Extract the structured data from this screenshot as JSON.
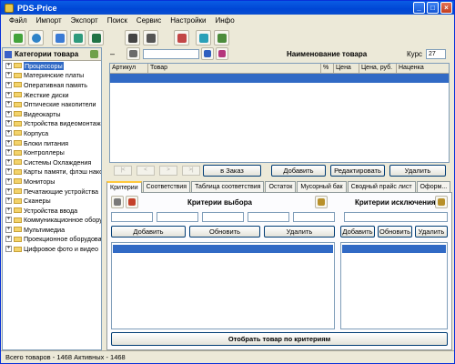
{
  "window": {
    "title": "PDS-Price"
  },
  "menu": [
    "Файл",
    "Импорт",
    "Экспорт",
    "Поиск",
    "Сервис",
    "Настройки",
    "Инфо"
  ],
  "left_panel": {
    "header": "Категории товара",
    "categories": [
      "Процессоры",
      "Материнские платы",
      "Оперативная память",
      "Жесткие диски",
      "Оптические накопители",
      "Видеокарты",
      "Устройства видеомонтажа",
      "Корпуса",
      "Блоки питания",
      "Контроллеры",
      "Системы Охлаждения",
      "Карты памяти, флэш накопители",
      "Мониторы",
      "Печатающие устройства",
      "Сканеры",
      "Устройства ввода",
      "Коммуникационное оборудование",
      "Мультимедиа",
      "Проекционное оборудование",
      "Цифровое фото и видео"
    ]
  },
  "product": {
    "search_value": "",
    "header": "Наименование товара",
    "rate_label": "Курс",
    "rate_value": "27",
    "columns": [
      "Артикул",
      "Товар",
      "%",
      "Цена",
      "Цена, руб.",
      "Наценка"
    ],
    "nav_buttons": [
      "|<",
      "<",
      ">",
      ">|"
    ],
    "order_button": "в Заказ",
    "add_button": "Добавить",
    "edit_button": "Редактировать",
    "delete_button": "Удалить"
  },
  "tabs": [
    "Критерии",
    "Соответствия",
    "Таблица соответствия",
    "Остаток",
    "Мусорный бак",
    "Сводный прайс лист",
    "Оформ..."
  ],
  "criteria": {
    "select_title": "Критерии выбора",
    "exclude_title": "Критерии исключения",
    "add_button": "Добавить",
    "update_button": "Обновить",
    "delete_button": "Удалить",
    "filter_button": "Отобрать товар по критериям"
  },
  "status": {
    "text": "Всего товаров - 1468   Активных - 1468"
  },
  "colors": {
    "selection": "#316ac5",
    "titlebar": "#0a5ce4",
    "window_bg": "#ece9d8"
  }
}
